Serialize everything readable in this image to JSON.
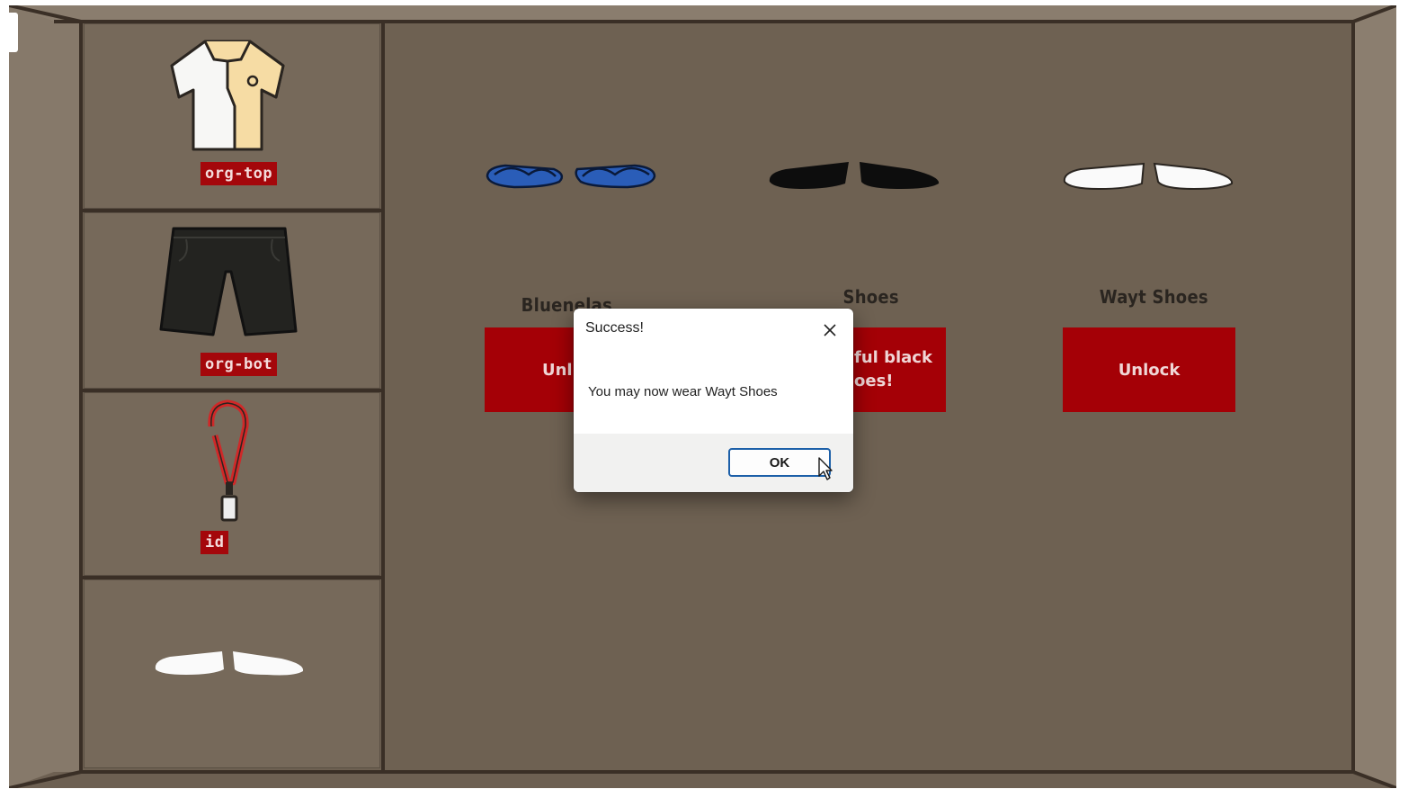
{
  "wardrobe": {
    "slots": [
      {
        "label": "org-top",
        "icon": "polo-shirt-icon"
      },
      {
        "label": "org-bot",
        "icon": "shorts-icon"
      },
      {
        "label": "id",
        "icon": "lanyard-icon"
      },
      {
        "label": "",
        "icon": "white-shoes-icon"
      }
    ]
  },
  "shop": {
    "items": [
      {
        "name": "Bluenelas",
        "button": "Unlock",
        "icon": "blue-sandals-icon"
      },
      {
        "name": "Shoes",
        "button": "Beautiful black shoes!",
        "visible_button_text": "ful black\noes!",
        "icon": "black-shoes-icon"
      },
      {
        "name": "Wayt Shoes",
        "button": "Unlock",
        "icon": "white-shoes-icon"
      }
    ],
    "partial": {
      "item0_name_visible": "Bluenelas",
      "item0_button_visible": "Unl",
      "item1_line1": "ful black",
      "item1_line2": "oes!"
    }
  },
  "dialog": {
    "title": "Success!",
    "message": "You may now wear Wayt Shoes",
    "ok_label": "OK",
    "close_icon": "close-icon"
  },
  "colors": {
    "accent_red": "#a40006",
    "panel": "#76695a",
    "frame": "#3a2f26",
    "ok_border": "#1c5fa8"
  }
}
